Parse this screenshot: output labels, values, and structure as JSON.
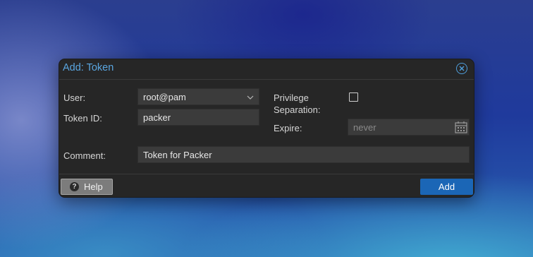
{
  "dialog": {
    "title": "Add: Token",
    "close_icon": "close-circle-icon",
    "fields": {
      "user": {
        "label": "User:",
        "value": "root@pam"
      },
      "token_id": {
        "label": "Token ID:",
        "value": "packer"
      },
      "privilege_separation": {
        "label_line1": "Privilege",
        "label_line2": "Separation:",
        "checked": false
      },
      "expire": {
        "label": "Expire:",
        "placeholder": "never"
      },
      "comment": {
        "label": "Comment:",
        "value": "Token for Packer"
      }
    },
    "footer": {
      "help_label": "Help",
      "help_icon": "question-circle-icon",
      "add_label": "Add"
    }
  },
  "colors": {
    "title": "#5aa6e0",
    "dialog_bg": "#262626",
    "field_bg": "#3b3b3b",
    "primary_button": "#1b66b6",
    "help_button": "#7c7c7c"
  }
}
